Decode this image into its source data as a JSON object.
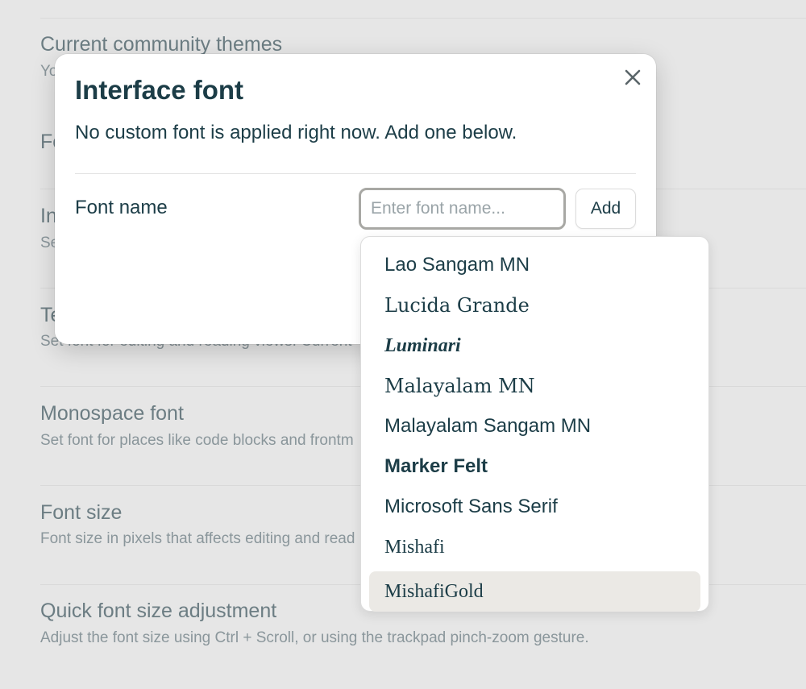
{
  "settings": [
    {
      "title": "Current community themes",
      "desc": "Yo"
    },
    {
      "title": "Fo",
      "desc": ""
    },
    {
      "title": "In",
      "desc": "Se"
    },
    {
      "title": "Te",
      "desc": "Set font for editing and reading views. Current"
    },
    {
      "title": "Monospace font",
      "desc": "Set font for places like code blocks and frontm"
    },
    {
      "title": "Font size",
      "desc": "Font size in pixels that affects editing and read"
    },
    {
      "title": "Quick font size adjustment",
      "desc": "Adjust the font size using Ctrl + Scroll, or using the trackpad pinch-zoom gesture."
    }
  ],
  "modal": {
    "title": "Interface font",
    "description": "No custom font is applied right now. Add one below.",
    "close_icon": "close-icon",
    "field_label": "Font name",
    "input_value": "",
    "input_placeholder": "Enter font name...",
    "add_label": "Add"
  },
  "dropdown": {
    "options": [
      "Lao Sangam MN",
      "Lucida Grande",
      "Luminari",
      "Malayalam MN",
      "Malayalam Sangam MN",
      "Marker Felt",
      "Microsoft Sans Serif",
      "Mishafi",
      "MishafiGold"
    ],
    "selected": "MishafiGold"
  }
}
